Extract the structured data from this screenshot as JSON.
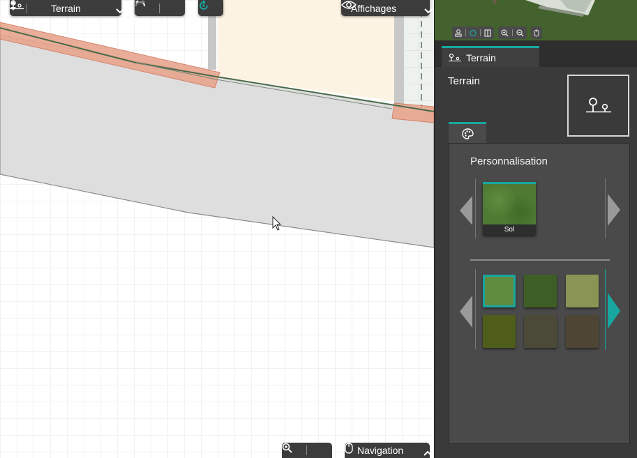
{
  "toolbar": {
    "terrain_label": "Terrain",
    "affichages_label": "Affichages",
    "navigation_label": "Navigation"
  },
  "panel": {
    "tab_label": "Terrain",
    "title": "Terrain",
    "section_title": "Personnalisation",
    "selected_texture_label": "Sol"
  },
  "colors": {
    "accent": "#17a7a0",
    "panel_bg": "#3a3a3a",
    "toolbar_bg": "#3c3c3c",
    "plot_gray": "#dedede",
    "building_fill": "#fdf3e3",
    "wall_orange": "#e8a58e"
  },
  "textures": [
    {
      "name": "grass-light",
      "color": "#5f8c3f",
      "selected": true
    },
    {
      "name": "grass-dark",
      "color": "#3d5f25",
      "selected": false
    },
    {
      "name": "grass-dry",
      "color": "#8a9455",
      "selected": false
    },
    {
      "name": "moss",
      "color": "#4e5e1a",
      "selected": false
    },
    {
      "name": "soil-grass",
      "color": "#4b4a38",
      "selected": false
    },
    {
      "name": "soil-brown",
      "color": "#4f4535",
      "selected": false
    }
  ]
}
